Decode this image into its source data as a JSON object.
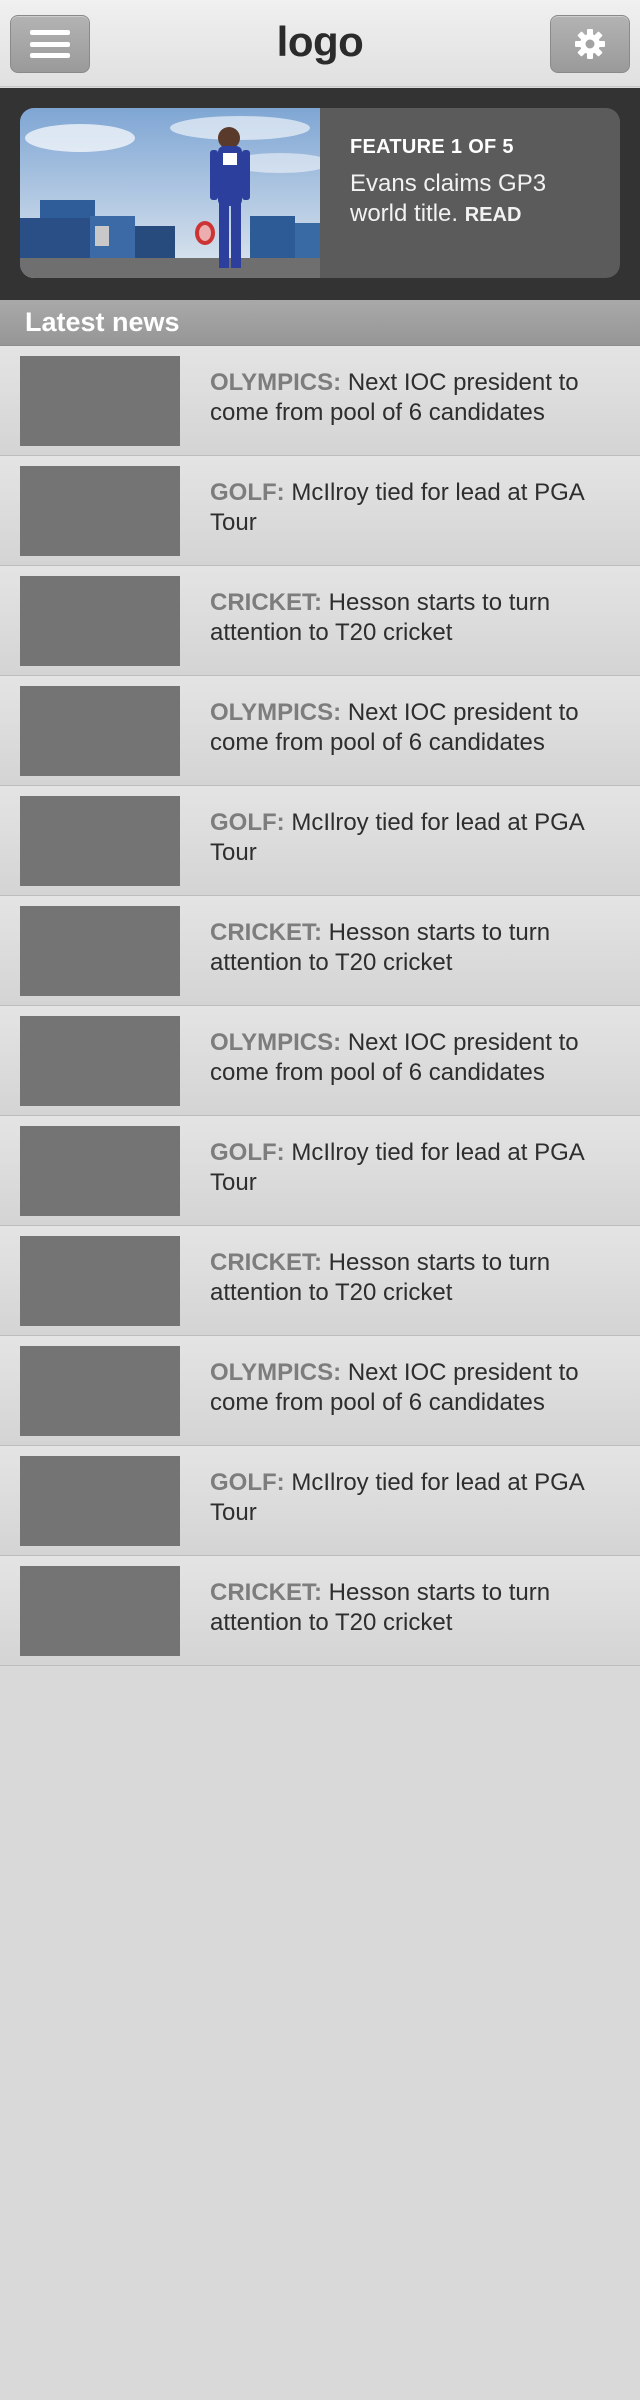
{
  "header": {
    "logo": "logo",
    "menu_icon": "hamburger-menu-icon",
    "settings_icon": "gear-icon"
  },
  "feature": {
    "count": "FEATURE 1 OF 5",
    "headline": "Evans claims GP3 world title.",
    "read_label": "READ",
    "image": "racing-driver-photo"
  },
  "latest": {
    "title": "Latest news"
  },
  "news": [
    {
      "category": "OLYMPICS:",
      "text": "Next IOC president to come from pool of 6 candidates"
    },
    {
      "category": "GOLF:",
      "text": "McIlroy tied for lead at PGA Tour"
    },
    {
      "category": "CRICKET:",
      "text": "Hesson starts to turn attention to T20 cricket"
    },
    {
      "category": "OLYMPICS:",
      "text": "Next IOC president to come from pool of 6 candidates"
    },
    {
      "category": "GOLF:",
      "text": "McIlroy tied for lead at PGA Tour"
    },
    {
      "category": "CRICKET:",
      "text": "Hesson starts to turn attention to T20 cricket"
    },
    {
      "category": "OLYMPICS:",
      "text": "Next IOC president to come from pool of 6 candidates"
    },
    {
      "category": "GOLF:",
      "text": "McIlroy tied for lead at PGA Tour"
    },
    {
      "category": "CRICKET:",
      "text": "Hesson starts to turn attention to T20 cricket"
    },
    {
      "category": "OLYMPICS:",
      "text": "Next IOC president to come from pool of 6 candidates"
    },
    {
      "category": "GOLF:",
      "text": "McIlroy tied for lead at PGA Tour"
    },
    {
      "category": "CRICKET:",
      "text": "Hesson starts to turn attention to T20 cricket"
    }
  ]
}
